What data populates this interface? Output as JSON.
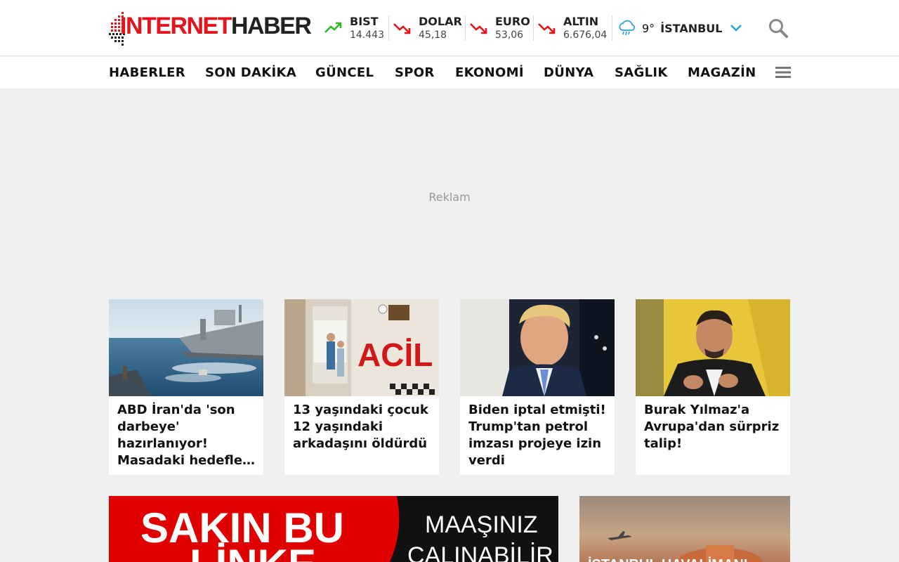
{
  "brand": {
    "logo_red": "INTERNET",
    "logo_dark": "HABER",
    "accent": "#e3141b"
  },
  "tickers": [
    {
      "name": "BIST",
      "value": "14.443",
      "trend": "up"
    },
    {
      "name": "DOLAR",
      "value": "45,18",
      "trend": "down"
    },
    {
      "name": "EURO",
      "value": "53,06",
      "trend": "down"
    },
    {
      "name": "ALTIN",
      "value": "6.676,04",
      "trend": "down"
    }
  ],
  "colors": {
    "up": "#2eb82e",
    "down": "#e3141b",
    "weather": "#29a3e0"
  },
  "weather": {
    "temp": "9°",
    "city": "İSTANBUL",
    "icon": "rain-cloud-icon"
  },
  "nav": [
    "HABERLER",
    "SON DAKİKA",
    "GÜNCEL",
    "SPOR",
    "EKONOMİ",
    "DÜNYA",
    "SAĞLIK",
    "MAGAZİN"
  ],
  "ad": {
    "label": "Reklam"
  },
  "cards": [
    {
      "title": "ABD İran'da 'son darbeye' hazırlanıyor! Masadaki hedefler belli oldu",
      "image": "navy-ship"
    },
    {
      "title": "13 yaşındaki çocuk 12 yaşındaki arkadaşını öldürdü",
      "image": "hospital-acil",
      "image_text": "ACİL"
    },
    {
      "title": "Biden iptal etmişti! Trump'tan petrol imzası projeye izin verdi",
      "image": "trump"
    },
    {
      "title": "Burak Yılmaz'a Avrupa'dan sürpriz talip!",
      "image": "coach"
    }
  ],
  "banner": {
    "left_text_1": "SAKIN BU",
    "left_text_2": "LİNKE",
    "right_text_1": "MAAŞINIZ",
    "right_text_2": "ÇALINABİLİR"
  },
  "side_card": {
    "text": "İSTANBUL HAVALİMANI"
  }
}
